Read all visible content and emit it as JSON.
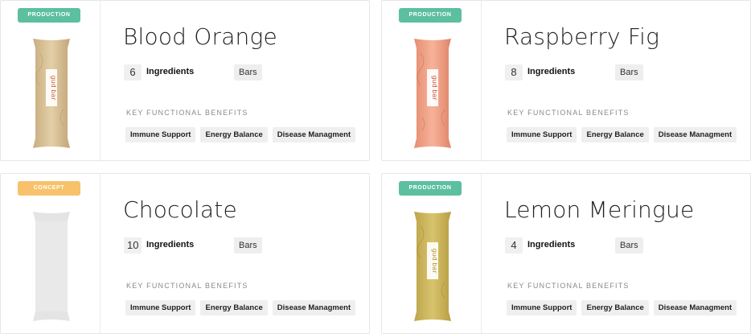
{
  "colors": {
    "production": "#5cbfa0",
    "concept": "#f7c26b",
    "blood_orange_bar": "#d9c29b",
    "raspberry_fig_bar": "#f0a98e",
    "chocolate_bar": "#e5e5e5",
    "lemon_meringue_bar": "#cdb75c"
  },
  "products": [
    {
      "status": "PRODUCTION",
      "name": "Blood Orange",
      "ingredient_count": "6",
      "ingredients_label": "Ingredients",
      "type": "Bars",
      "benefits_label": "KEY FUNCTIONAL BENEFITS",
      "benefits": [
        "Immune Support",
        "Energy Balance",
        "Disease Managment"
      ],
      "bar_brand": "gud bar"
    },
    {
      "status": "PRODUCTION",
      "name": "Raspberry Fig",
      "ingredient_count": "8",
      "ingredients_label": "Ingredients",
      "type": "Bars",
      "benefits_label": "KEY FUNCTIONAL BENEFITS",
      "benefits": [
        "Immune Support",
        "Energy Balance",
        "Disease Managment"
      ],
      "bar_brand": "gud bar"
    },
    {
      "status": "CONCEPT",
      "name": "Chocolate",
      "ingredient_count": "10",
      "ingredients_label": "Ingredients",
      "type": "Bars",
      "benefits_label": "KEY FUNCTIONAL BENEFITS",
      "benefits": [
        "Immune Support",
        "Energy Balance",
        "Disease Managment"
      ],
      "bar_brand": ""
    },
    {
      "status": "PRODUCTION",
      "name": "Lemon Meringue",
      "ingredient_count": "4",
      "ingredients_label": "Ingredients",
      "type": "Bars",
      "benefits_label": "KEY FUNCTIONAL BENEFITS",
      "benefits": [
        "Immune Support",
        "Energy Balance",
        "Disease Managment"
      ],
      "bar_brand": "gud bar"
    }
  ]
}
